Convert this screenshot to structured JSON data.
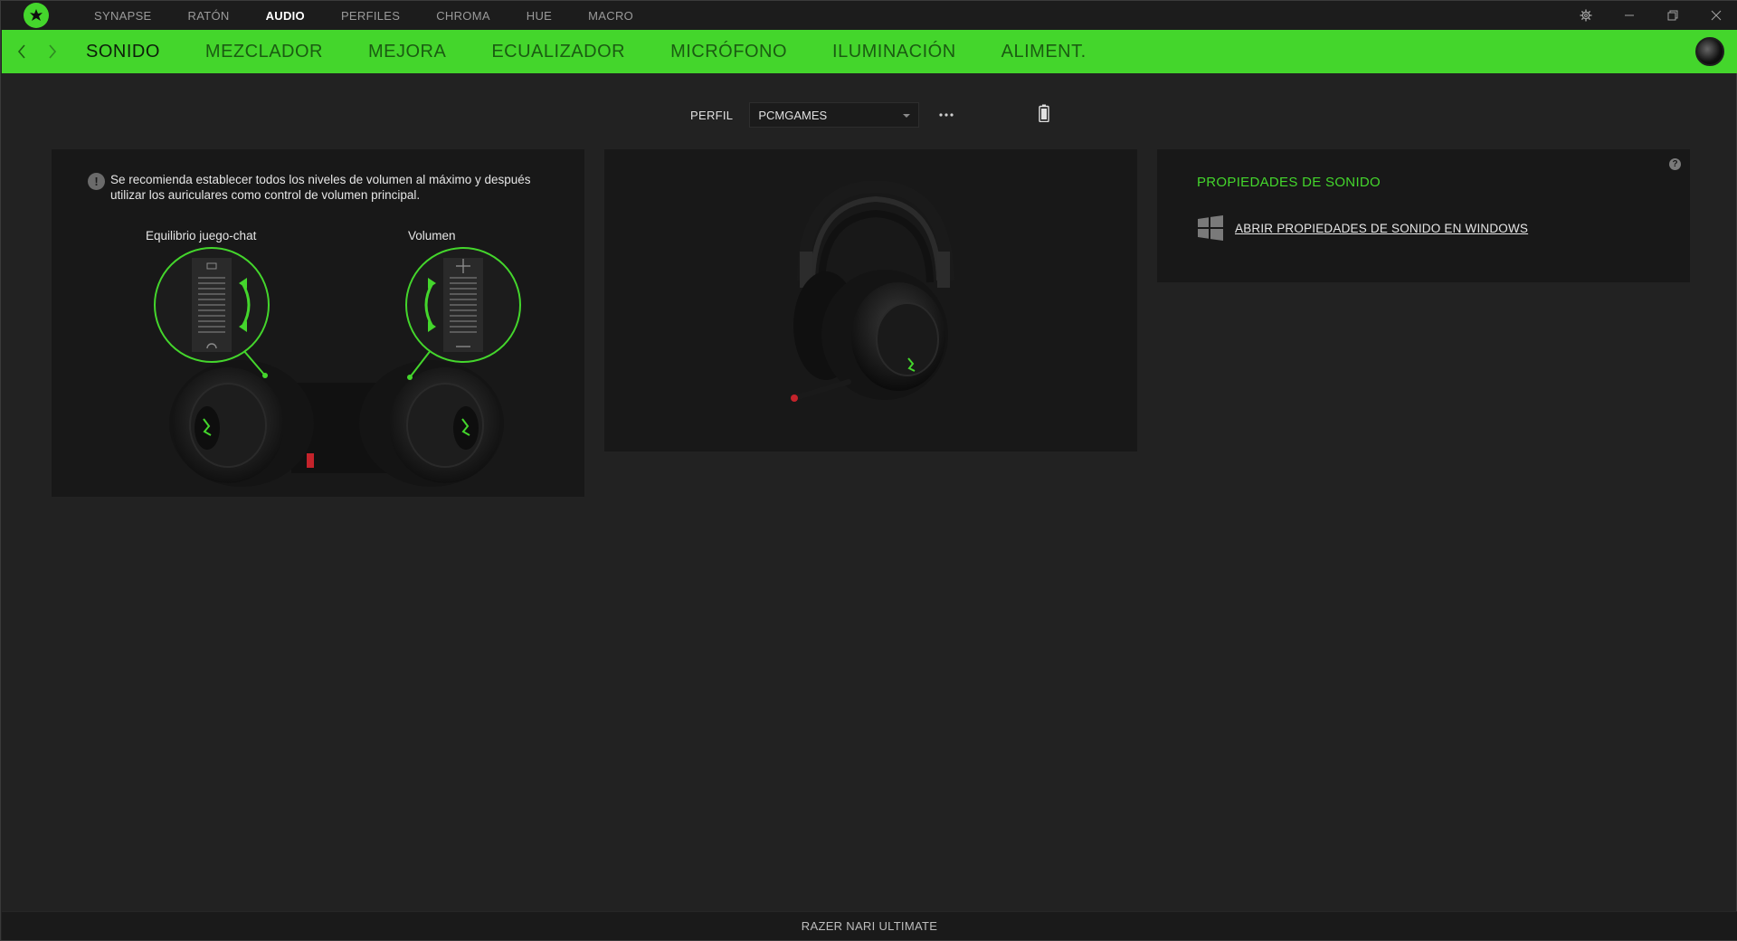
{
  "top_nav": {
    "items": [
      {
        "label": "SYNAPSE",
        "active": false
      },
      {
        "label": "RATÓN",
        "active": false
      },
      {
        "label": "AUDIO",
        "active": true
      },
      {
        "label": "PERFILES",
        "active": false
      },
      {
        "label": "CHROMA",
        "active": false
      },
      {
        "label": "HUE",
        "active": false
      },
      {
        "label": "MACRO",
        "active": false
      }
    ],
    "window_controls": [
      "gear-icon",
      "minimize-icon",
      "restore-icon",
      "close-icon"
    ]
  },
  "sub_nav": {
    "tabs": [
      {
        "label": "SONIDO",
        "active": true
      },
      {
        "label": "MEZCLADOR",
        "active": false
      },
      {
        "label": "MEJORA",
        "active": false
      },
      {
        "label": "ECUALIZADOR",
        "active": false
      },
      {
        "label": "MICRÓFONO",
        "active": false
      },
      {
        "label": "ILUMINACIÓN",
        "active": false
      },
      {
        "label": "ALIMENT.",
        "active": false
      }
    ]
  },
  "profile": {
    "label": "PERFIL",
    "selected": "PCMGAMES"
  },
  "volume_card": {
    "info_icon": "!",
    "info_text": "Se recomienda establecer todos los niveles de volumen al máximo y después utilizar los auriculares como control de volumen principal.",
    "dial_left_label": "Equilibrio juego-chat",
    "dial_right_label": "Volumen"
  },
  "sound_properties": {
    "title": "PROPIEDADES DE SONIDO",
    "help_icon": "?",
    "link_text": "ABRIR PROPIEDADES DE SONIDO EN WINDOWS"
  },
  "footer": {
    "device_name": "RAZER NARI ULTIMATE"
  },
  "colors": {
    "accent": "#44d62c",
    "background": "#222222",
    "card": "#181818"
  }
}
